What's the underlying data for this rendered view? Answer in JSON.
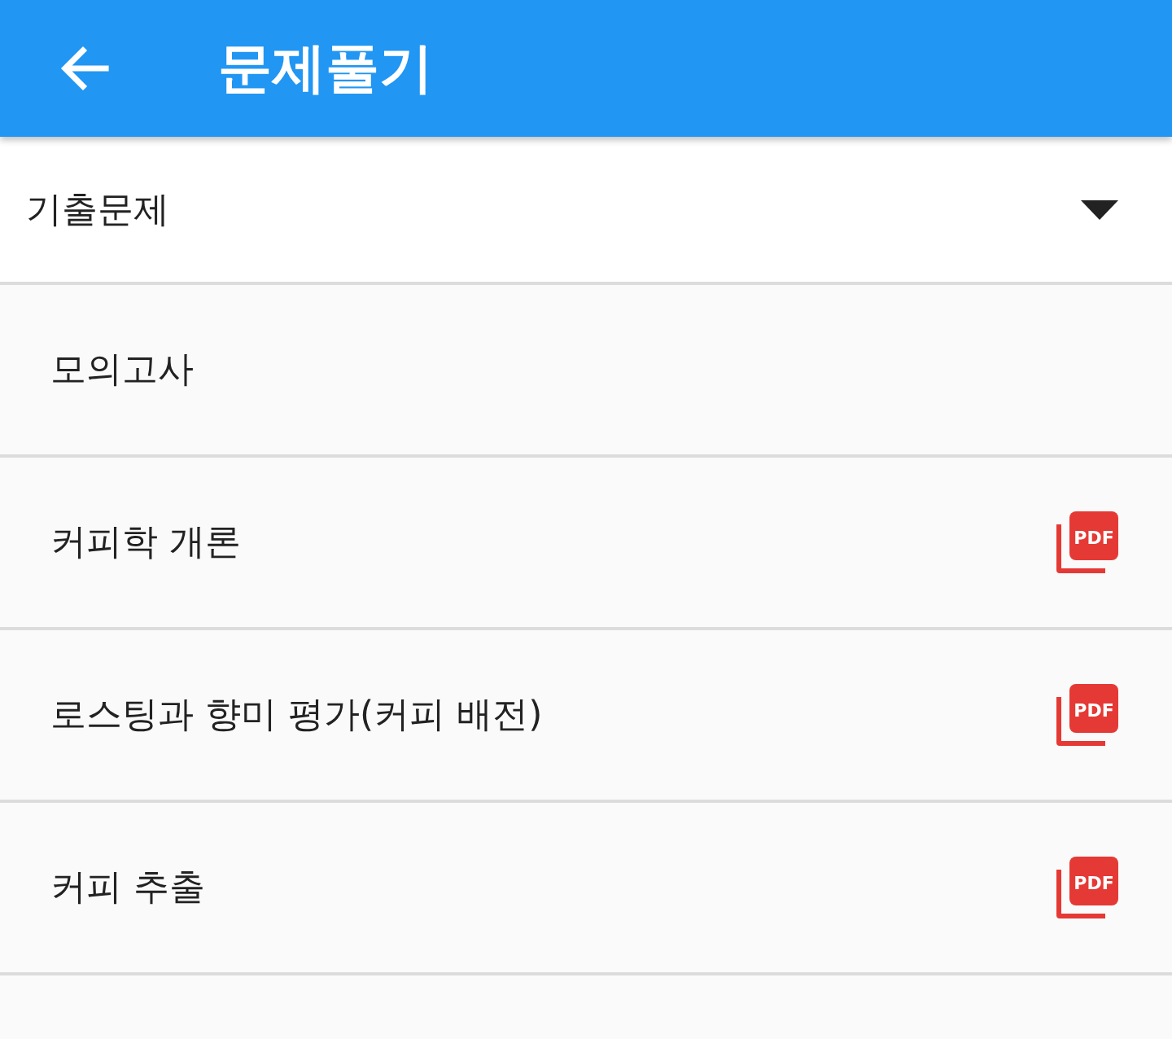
{
  "app_bar": {
    "title": "문제풀기"
  },
  "dropdown": {
    "value": "기출문제"
  },
  "items": [
    {
      "title": "모의고사"
    },
    {
      "title": "커피학 개론",
      "badge": "PDF"
    },
    {
      "title": "로스팅과 향미 평가(커피 배전)",
      "badge": "PDF"
    },
    {
      "title": "커피 추출",
      "badge": "PDF"
    }
  ]
}
